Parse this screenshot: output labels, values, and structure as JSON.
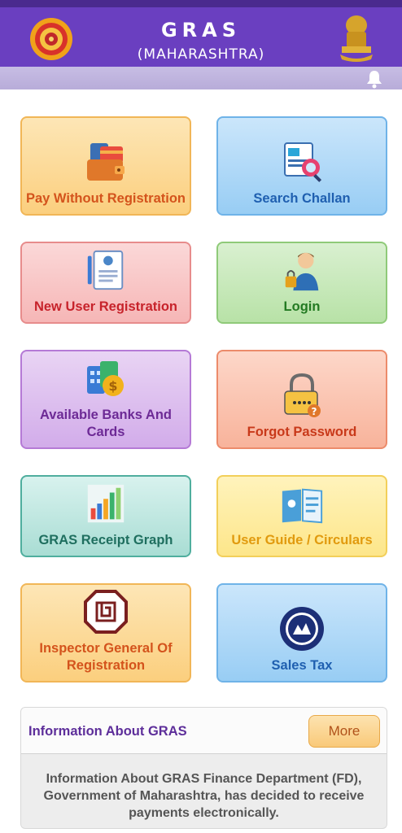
{
  "header": {
    "title": "GRAS",
    "subtitle": "(MAHARASHTRA)",
    "left_logo": "maharashtra-emblem-icon",
    "right_logo": "india-emblem-icon",
    "notification_icon": "bell-icon"
  },
  "tiles": [
    {
      "label": "Pay Without Registration",
      "icon": "wallet-card-icon",
      "color": "#d4531c"
    },
    {
      "label": "Search Challan",
      "icon": "search-document-icon",
      "color": "#1f5fb0"
    },
    {
      "label": "New User Registration",
      "icon": "registration-form-icon",
      "color": "#c7232b"
    },
    {
      "label": "Login",
      "icon": "user-lock-icon",
      "color": "#237a22"
    },
    {
      "label": "Available Banks And Cards",
      "icon": "bank-coins-icon",
      "color": "#6d2a96"
    },
    {
      "label": "Forgot Password",
      "icon": "padlock-question-icon",
      "color": "#c8391a"
    },
    {
      "label": "GRAS Receipt Graph",
      "icon": "bar-chart-icon",
      "color": "#1f6f5f"
    },
    {
      "label": "User Guide / Circulars",
      "icon": "guide-book-icon",
      "color": "#e19a0e"
    },
    {
      "label": "Inspector General Of Registration",
      "icon": "igr-logo-icon",
      "color": "#d4531c"
    },
    {
      "label": "Sales Tax",
      "icon": "sales-tax-seal-icon",
      "color": "#c8391a"
    }
  ],
  "info": {
    "title": "Information About GRAS",
    "more_label": "More",
    "body": "Information About GRAS Finance Department (FD), Government of Maharashtra, has decided to receive payments electronically."
  }
}
